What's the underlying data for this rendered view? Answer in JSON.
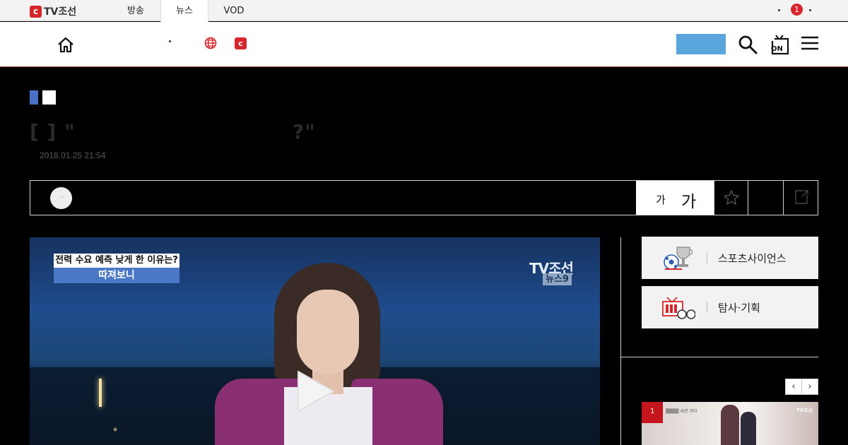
{
  "gnb": {
    "logo_text": "TV조선",
    "logo_mark": "c",
    "tabs": [
      {
        "label": "방송",
        "active": false
      },
      {
        "label": "뉴스",
        "active": true
      },
      {
        "label": "VOD",
        "active": false
      }
    ],
    "notification_count": "1"
  },
  "header": {
    "icons": [
      "home-icon",
      "globe-icon",
      "tvchosun-icon",
      "search-icon",
      "tv-on-icon",
      "menu-icon"
    ],
    "tvc_icon_glyph": "c",
    "login_button_color": "#5aa6dc"
  },
  "article": {
    "title_open": "[      ] \"",
    "title_close": "?\"",
    "date": "2018.01.25 21:54",
    "category_color": "#4a72c4",
    "reporter_avatar_text": "···"
  },
  "toolbar": {
    "font_small": "가",
    "font_large": "가",
    "icons": [
      "star-icon",
      "share-icon"
    ]
  },
  "video": {
    "caption_top": "전력 수요 예측 낮게 한 이유는?",
    "caption_bottom": "따져보니",
    "watermark_main": "TV조선",
    "watermark_sub": "뉴스9",
    "play_icon": "play-icon"
  },
  "sidebar": {
    "banners": [
      {
        "label": "스포츠사이언스",
        "icon": "sports-trophy-icon"
      },
      {
        "label": "탐사·기획",
        "icon": "tv-glasses-icon"
      }
    ],
    "prev_label": "‹",
    "next_label": "›",
    "thumb_rank": "1",
    "thumb_caption": "▒▒▒▒ 사건 가다",
    "thumb_watermark": "TV조선"
  },
  "colors": {
    "brand_red": "#d8252b",
    "accent_blue": "#4a78c6",
    "background": "#000000"
  }
}
